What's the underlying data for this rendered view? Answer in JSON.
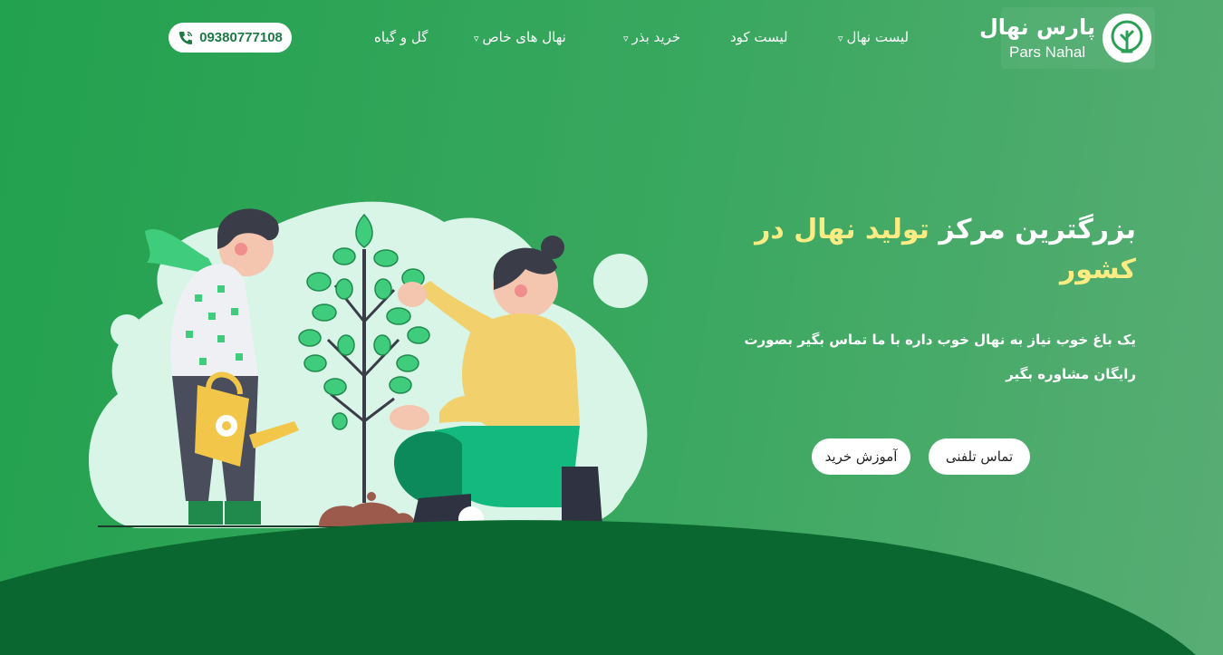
{
  "brand": {
    "name_fa": "پارس نهال",
    "name_en": "Pars Nahal",
    "logo_icon": "tree-icon"
  },
  "nav": {
    "items": [
      {
        "label": "لیست نهال",
        "has_dropdown": true
      },
      {
        "label": "لیست کود",
        "has_dropdown": false
      },
      {
        "label": "خرید بذر",
        "has_dropdown": true
      },
      {
        "label": "نهال های خاص",
        "has_dropdown": true
      },
      {
        "label": "گل و گیاه",
        "has_dropdown": false
      }
    ],
    "caret": "▿"
  },
  "phone": {
    "number": "09380777108",
    "icon": "phone-icon"
  },
  "hero": {
    "title_part1": "بزرگترین مرکز",
    "title_highlight": "تولید نهال در کشور",
    "description": "یک باغ خوب نیاز به نهال خوب داره با ما تماس بگیر بصورت رایگان مشاوره بگیر",
    "buttons": {
      "call": "تماس تلفنی",
      "guide": "آموزش خرید"
    }
  },
  "colors": {
    "primary": "#22a14e",
    "dark_ground": "#0b6730",
    "highlight": "#fdeb83",
    "blob": "#d8f5e8"
  }
}
